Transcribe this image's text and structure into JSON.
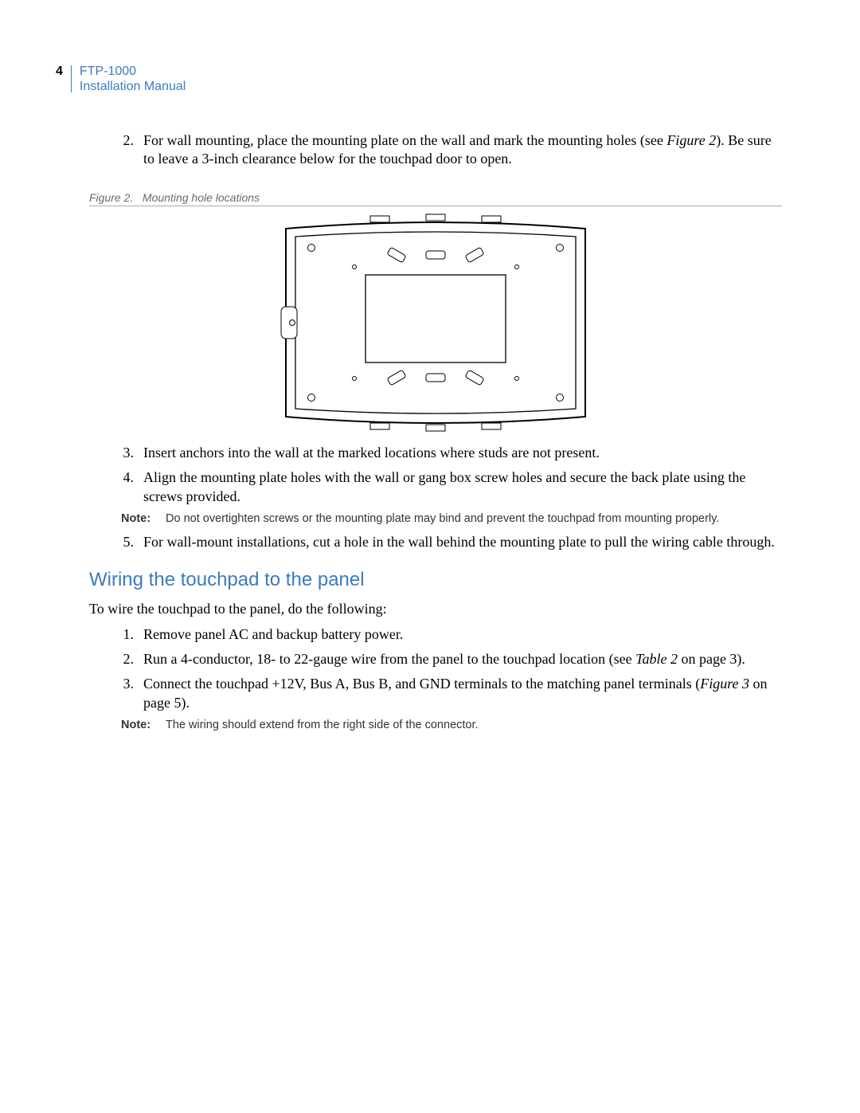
{
  "header": {
    "page_number": "4",
    "product": "FTP-1000",
    "subtitle": "Installation Manual"
  },
  "step2": {
    "num": "2.",
    "text_pre": "For wall mounting, place the mounting plate on the wall and mark the mounting holes (see ",
    "fig_ref": "Figure 2",
    "text_post": "). Be sure to leave a 3-inch clearance below for the touchpad door to open."
  },
  "figure_caption": {
    "label": "Figure 2.",
    "text": "Mounting hole locations"
  },
  "step3": {
    "num": "3.",
    "text": "Insert anchors into the wall at the marked locations where studs are not present."
  },
  "step4": {
    "num": "4.",
    "text": "Align the mounting plate holes with the wall or gang box screw holes and secure the back plate using the screws provided."
  },
  "note1": {
    "label": "Note:",
    "text": "Do not overtighten screws or the mounting plate may bind and prevent the touchpad from mounting properly."
  },
  "step5": {
    "num": "5.",
    "text": "For wall-mount installations, cut a hole in the wall behind the mounting plate to pull  the wiring cable through."
  },
  "section_heading": "Wiring the touchpad to the panel",
  "intro": "To wire the touchpad to the panel, do the following:",
  "wstep1": {
    "num": "1.",
    "text": "Remove panel AC and backup battery power."
  },
  "wstep2": {
    "num": "2.",
    "text_pre": "Run a 4-conductor, 18- to 22-gauge wire from the panel to the touchpad location (see ",
    "ref": "Table 2",
    "text_post": " on page 3)."
  },
  "wstep3": {
    "num": "3.",
    "text_pre": "Connect the touchpad +12V, Bus A, Bus B, and GND terminals to the matching panel terminals (",
    "ref": "Figure 3",
    "text_post": " on page 5)."
  },
  "note2": {
    "label": "Note:",
    "text": "The wiring should extend from the right side of the connector."
  }
}
